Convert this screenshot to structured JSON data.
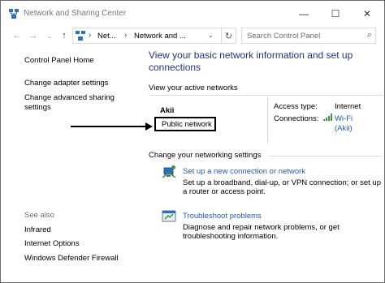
{
  "window": {
    "title": "Network and Sharing Center",
    "minimize_glyph": "—",
    "maximize_glyph": "☐",
    "close_glyph": "✕"
  },
  "addressbar": {
    "crumbs": [
      "Net...",
      "Network and ..."
    ],
    "search_placeholder": "Search Control Panel"
  },
  "sidebar": {
    "items": [
      "Control Panel Home",
      "Change adapter settings",
      "Change advanced sharing settings"
    ],
    "see_also_label": "See also",
    "see_also_items": [
      "Infrared",
      "Internet Options",
      "Windows Defender Firewall"
    ]
  },
  "main": {
    "heading": "View your basic network information and set up connections",
    "active_networks_label": "View your active networks",
    "network": {
      "name": "Akii",
      "type": "Public network",
      "access_type_label": "Access type:",
      "access_type_value": "Internet",
      "connections_label": "Connections:",
      "connection_name": "Wi-Fi",
      "connection_ssid": "(Akii)"
    },
    "change_settings_label": "Change your networking settings",
    "tasks": [
      {
        "icon": "new-connection-icon",
        "title": "Set up a new connection or network",
        "description": "Set up a broadband, dial-up, or VPN connection; or set up a router or access point."
      },
      {
        "icon": "troubleshoot-icon",
        "title": "Troubleshoot problems",
        "description": "Diagnose and repair network problems, or get troubleshooting information."
      }
    ]
  },
  "colors": {
    "heading_blue": "#1e3287",
    "link_blue": "#1e5bbf",
    "muted_gray": "#6d6d6d",
    "wifi_green": "#3a9a3a"
  }
}
